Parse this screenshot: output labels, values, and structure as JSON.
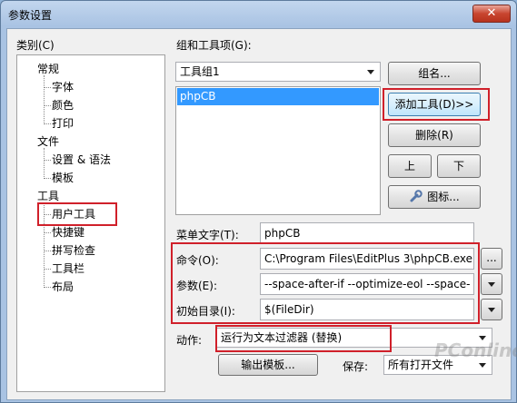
{
  "window": {
    "title": "参数设置",
    "close_glyph": "✕"
  },
  "category": {
    "label": "类别(C)",
    "items": [
      {
        "text": "常规",
        "level": 0
      },
      {
        "text": "字体",
        "level": 1
      },
      {
        "text": "颜色",
        "level": 1
      },
      {
        "text": "打印",
        "level": 1
      },
      {
        "text": "文件",
        "level": 0
      },
      {
        "text": "设置 & 语法",
        "level": 1
      },
      {
        "text": "模板",
        "level": 1
      },
      {
        "text": "工具",
        "level": 0
      },
      {
        "text": "用户工具",
        "level": 1,
        "selected": true
      },
      {
        "text": "快捷键",
        "level": 1
      },
      {
        "text": "拼写检查",
        "level": 1
      },
      {
        "text": "工具栏",
        "level": 1
      },
      {
        "text": "布局",
        "level": 1
      }
    ]
  },
  "groups": {
    "label": "组和工具项(G):",
    "selected_group": "工具组1",
    "tools": [
      "phpCB"
    ],
    "buttons": {
      "group_name": "组名...",
      "add_tool": "添加工具(D)>>",
      "delete": "删除(R)",
      "up": "上",
      "down": "下",
      "icon": "图标..."
    }
  },
  "form": {
    "menu_text_label": "菜单文字(T):",
    "menu_text_value": "phpCB",
    "command_label": "命令(O):",
    "command_value": "C:\\Program Files\\EditPlus 3\\phpCB.exe",
    "browse_label": "...",
    "args_label": "参数(E):",
    "args_value": "--space-after-if --optimize-eol --space-",
    "initdir_label": "初始目录(I):",
    "initdir_value": "$(FileDir)",
    "action_label": "动作:",
    "action_value": "运行为文本过滤器 (替换)",
    "output_template_label": "输出模板...",
    "save_label": "保存:",
    "save_value": "所有打开文件"
  },
  "watermark": {
    "text": "PConline"
  },
  "colors": {
    "highlight": "#3399ff",
    "annotation_red": "#d0202a"
  }
}
